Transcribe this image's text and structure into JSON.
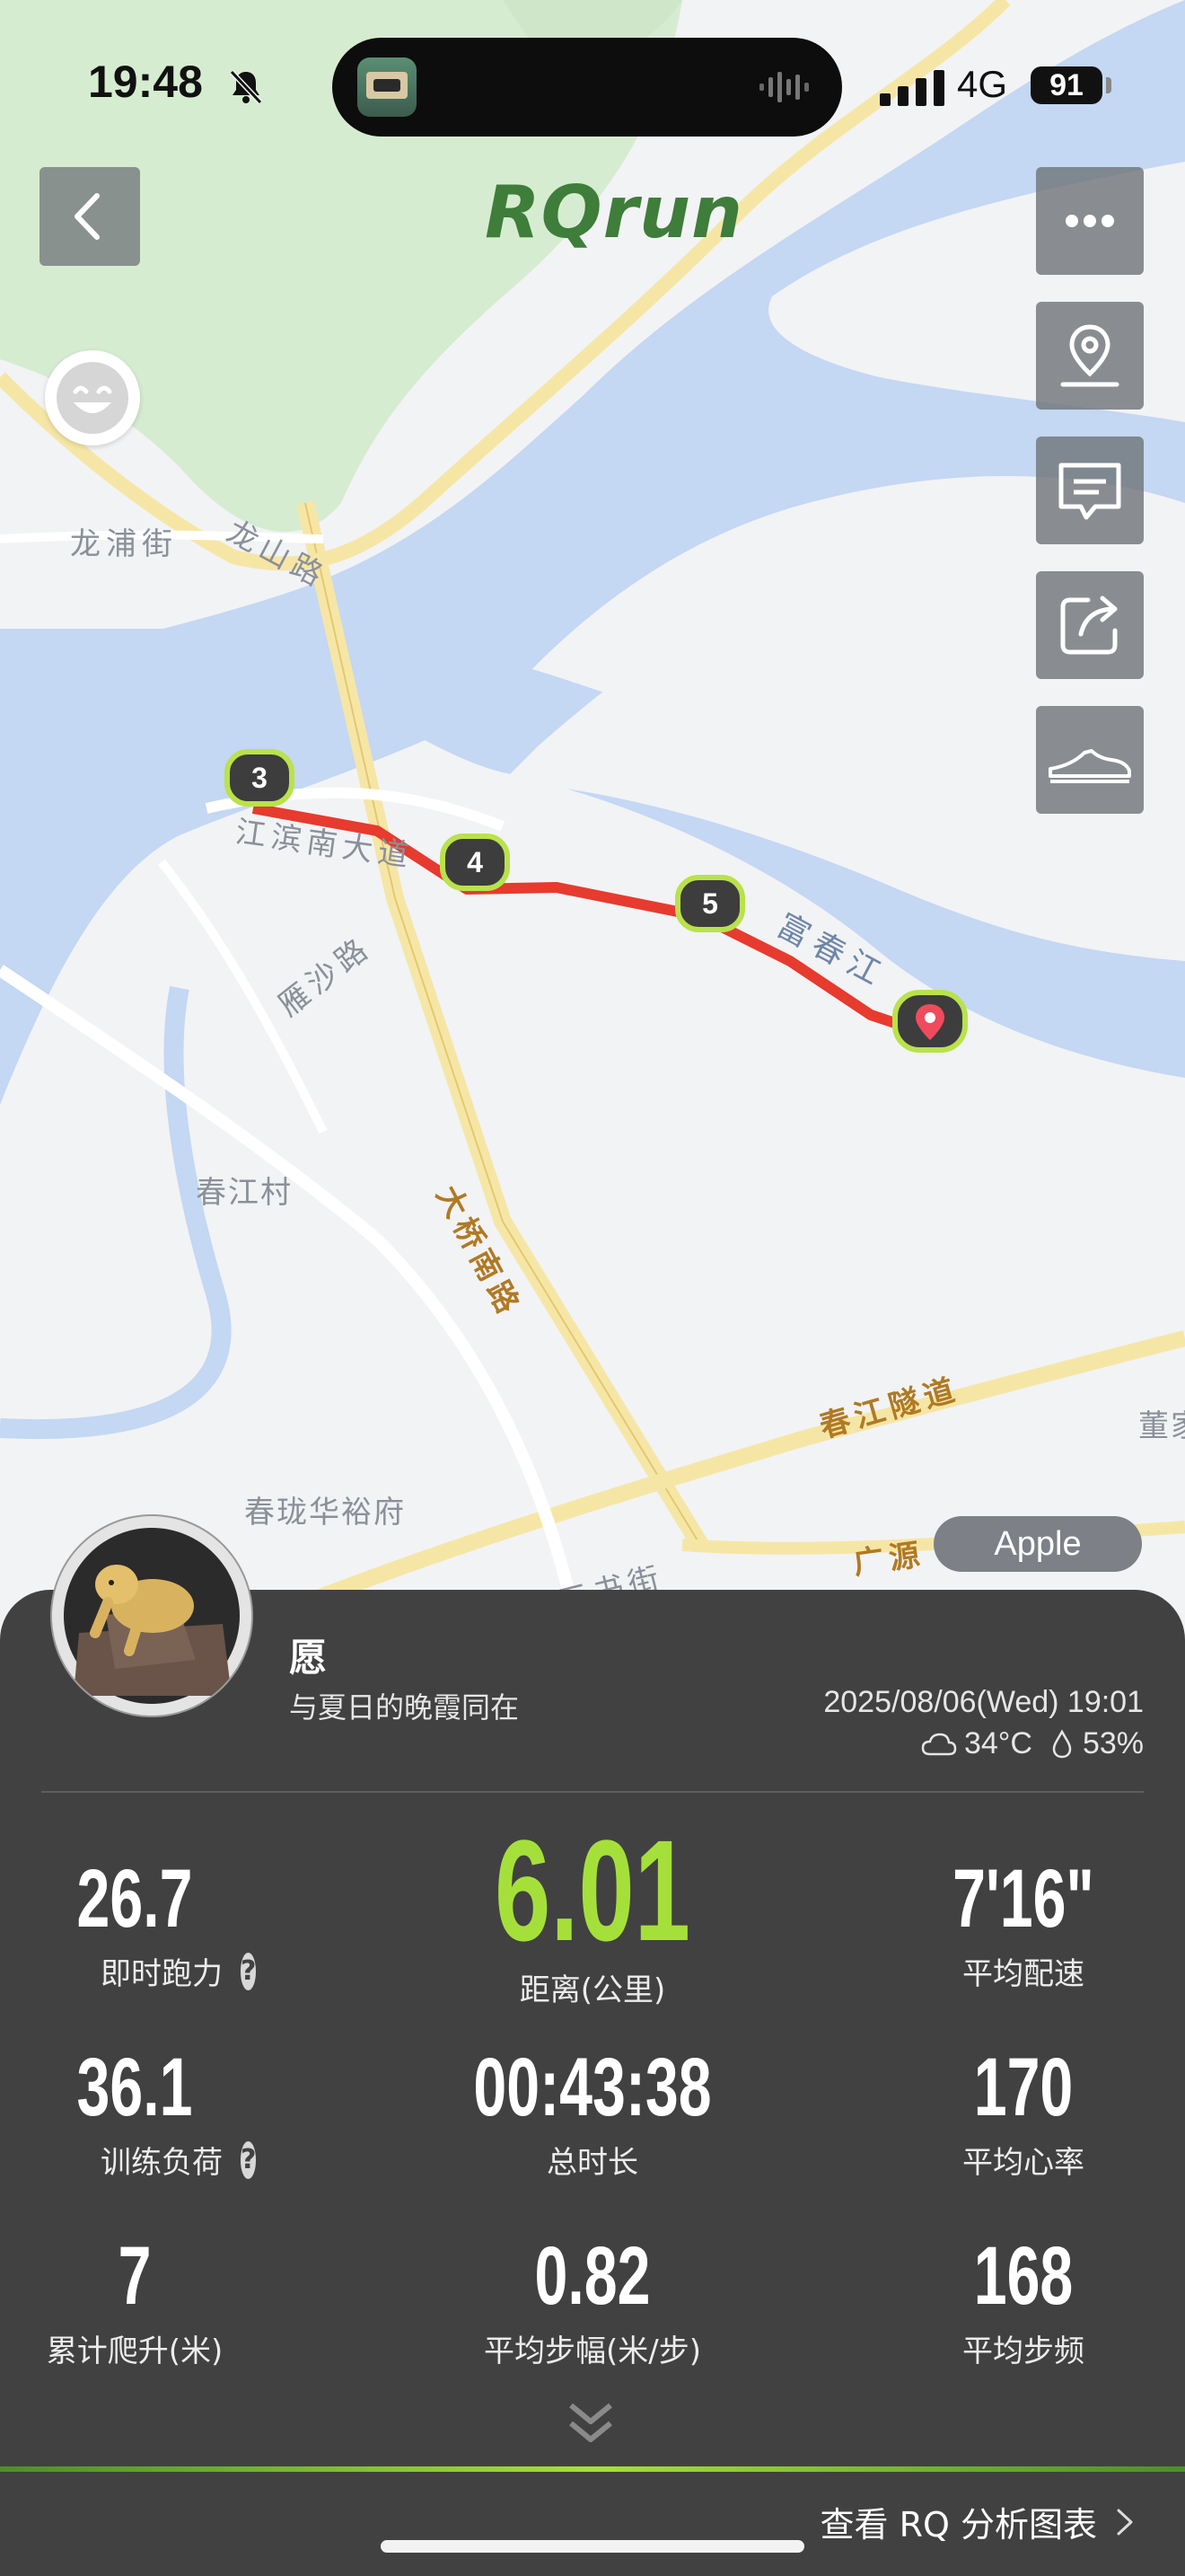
{
  "status_bar": {
    "time": "19:48",
    "network": "4G",
    "battery": "91"
  },
  "map": {
    "brand": "RQrun",
    "labels": {
      "longpu": "龙浦街",
      "longshan": "龙山路",
      "jiangbin": "江滨南大道",
      "yansha": "雁沙路",
      "fuchun": "富春江",
      "chunjiang_village": "春江村",
      "daqiao": "大桥南路",
      "tunnel": "春江隧道",
      "dong": "董家",
      "huayu": "春珑华裕府",
      "guangyuan": "广源",
      "street_bottom": "三书街"
    },
    "km_markers": [
      "3",
      "4",
      "5"
    ],
    "source_badge": "Apple"
  },
  "user": {
    "name": "愿",
    "motto": "与夏日的晚霞同在",
    "date": "2025/08/06(Wed) 19:01",
    "temperature": "34°C",
    "humidity": "53%"
  },
  "stats": [
    {
      "value": "26.7",
      "label": "即时跑力",
      "help": true
    },
    {
      "value": "6.01",
      "label": "距离(公里)",
      "help": false,
      "highlight": true
    },
    {
      "value": "7'16\"",
      "label": "平均配速",
      "help": false
    },
    {
      "value": "36.1",
      "label": "训练负荷",
      "help": true
    },
    {
      "value": "00:43:38",
      "label": "总时长",
      "help": false
    },
    {
      "value": "170",
      "label": "平均心率",
      "help": false
    },
    {
      "value": "7",
      "label": "累计爬升(米)",
      "help": false
    },
    {
      "value": "0.82",
      "label": "平均步幅(米/步)",
      "help": false
    },
    {
      "value": "168",
      "label": "平均步频",
      "help": false
    }
  ],
  "help_icon": "?",
  "footer": {
    "cta": "查看 RQ 分析图表"
  },
  "colors": {
    "accent_green": "#a5e03a",
    "route_red": "#e63b2e",
    "panel_bg": "#414141"
  }
}
